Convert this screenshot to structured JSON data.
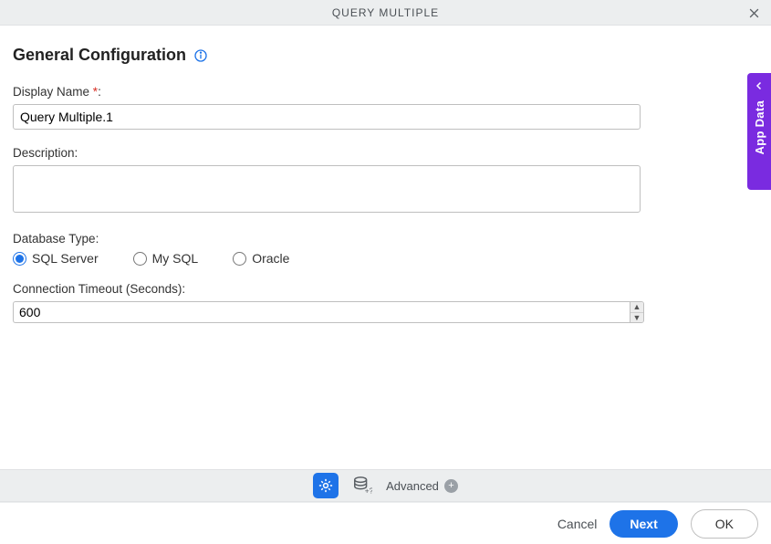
{
  "header": {
    "title": "QUERY MULTIPLE"
  },
  "section": {
    "title": "General Configuration"
  },
  "fields": {
    "displayName": {
      "label": "Display Name",
      "required": "*",
      "colon": ":",
      "value": "Query Multiple.1"
    },
    "description": {
      "label": "Description:",
      "value": ""
    },
    "databaseType": {
      "label": "Database Type:",
      "options": [
        "SQL Server",
        "My SQL",
        "Oracle"
      ],
      "selected": "SQL Server"
    },
    "connectionTimeout": {
      "label": "Connection Timeout (Seconds):",
      "value": "600"
    }
  },
  "sidebar": {
    "label": "App Data"
  },
  "tabbar": {
    "advanced": "Advanced"
  },
  "footer": {
    "cancel": "Cancel",
    "next": "Next",
    "ok": "OK"
  }
}
